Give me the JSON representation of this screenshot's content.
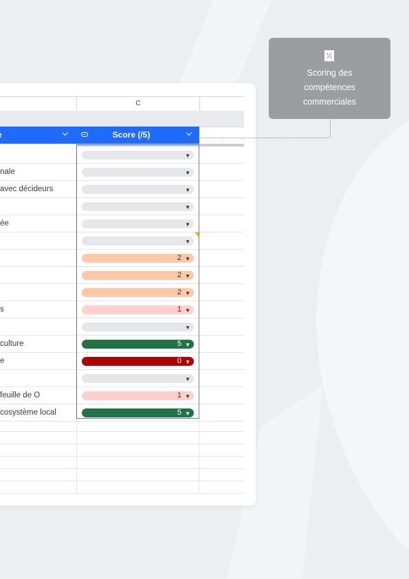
{
  "sheet": {
    "column_header_c": "C",
    "header": {
      "left_label": "e",
      "score_label": "Score (/5)"
    },
    "rows": [
      {
        "name": "",
        "score": "",
        "level": "empty"
      },
      {
        "name": "nale",
        "score": "",
        "level": "empty"
      },
      {
        "name": "avec décideurs",
        "score": "",
        "level": "empty"
      },
      {
        "name": "",
        "score": "",
        "level": "empty"
      },
      {
        "name": "ée",
        "score": "",
        "level": "empty"
      },
      {
        "name": "",
        "score": "",
        "level": "empty"
      },
      {
        "name": "",
        "score": "2",
        "level": "mid"
      },
      {
        "name": "",
        "score": "2",
        "level": "mid"
      },
      {
        "name": "",
        "score": "2",
        "level": "mid"
      },
      {
        "name": "s",
        "score": "1",
        "level": "low"
      },
      {
        "name": "",
        "score": "",
        "level": "empty"
      },
      {
        "name": "culture",
        "score": "5",
        "level": "high"
      },
      {
        "name": "e",
        "score": "0",
        "level": "zero"
      },
      {
        "name": "",
        "score": "",
        "level": "empty"
      },
      {
        "name": "feuille de O",
        "score": "1",
        "level": "low"
      },
      {
        "name": "cosystème local",
        "score": "5",
        "level": "high"
      }
    ]
  },
  "tooltip": {
    "text": "Scoring des\ncompétences\ncommerciales",
    "icon": "percent-receipt-icon"
  },
  "colors": {
    "header_blue": "#1f6bff",
    "empty": "#e5e7eb",
    "mid": "#ffc9a8",
    "low": "#ffd0cc",
    "high": "#217346",
    "zero": "#b10202",
    "tooltip_bg": "#9b9da1"
  }
}
